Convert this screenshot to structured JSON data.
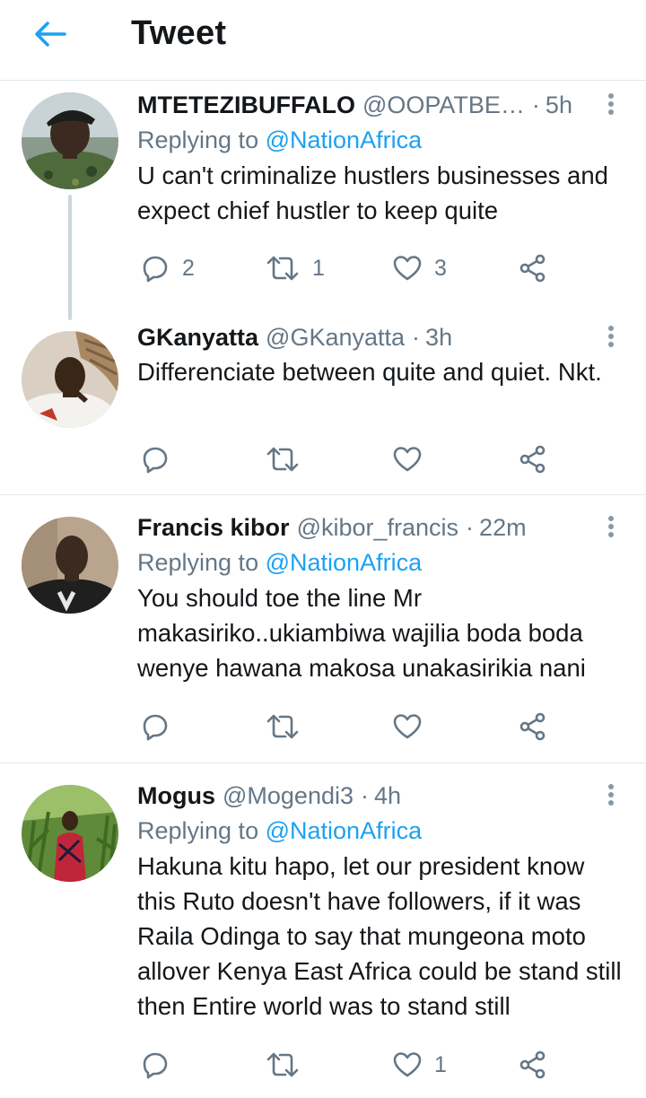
{
  "header": {
    "title": "Tweet"
  },
  "tweets": [
    {
      "name": "MTETEZIBUFFALO",
      "handle": "@OOPATBE…",
      "time": "5h",
      "replying_label": "Replying to",
      "replying_to": "@NationAfrica",
      "text": "U can't criminalize hustlers businesses and expect chief hustler to keep quite",
      "replies": "2",
      "retweets": "1",
      "likes": "3"
    },
    {
      "name": "GKanyatta",
      "handle": "@GKanyatta",
      "time": "3h",
      "text": "Differenciate between quite and quiet. Nkt."
    },
    {
      "name": "Francis kibor",
      "handle": "@kibor_francis",
      "time": "22m",
      "replying_label": "Replying to",
      "replying_to": "@NationAfrica",
      "text": "You should toe the line Mr makasiriko..ukiambiwa wajilia boda boda wenye hawana makosa unakasirikia nani"
    },
    {
      "name": "Mogus",
      "handle": "@Mogendi3",
      "time": "4h",
      "replying_label": "Replying to",
      "replying_to": "@NationAfrica",
      "text": "Hakuna kitu hapo, let our president know this Ruto doesn't have followers, if it was Raila Odinga to say that mungeona moto allover Kenya East Africa could be stand still then Entire world was to stand still",
      "likes": "1"
    }
  ],
  "colors": {
    "accent": "#1da1f2",
    "secondary": "#657786",
    "text": "#14171a",
    "divider": "#e1e8ed"
  }
}
